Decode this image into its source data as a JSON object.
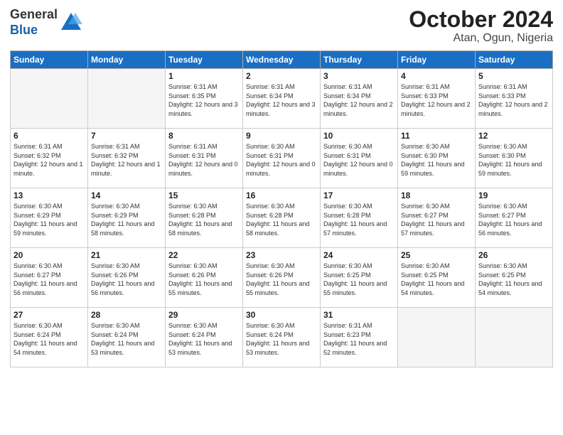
{
  "logo": {
    "general": "General",
    "blue": "Blue"
  },
  "title": {
    "month": "October 2024",
    "location": "Atan, Ogun, Nigeria"
  },
  "headers": [
    "Sunday",
    "Monday",
    "Tuesday",
    "Wednesday",
    "Thursday",
    "Friday",
    "Saturday"
  ],
  "weeks": [
    [
      {
        "day": "",
        "info": ""
      },
      {
        "day": "",
        "info": ""
      },
      {
        "day": "1",
        "info": "Sunrise: 6:31 AM\nSunset: 6:35 PM\nDaylight: 12 hours and 3 minutes."
      },
      {
        "day": "2",
        "info": "Sunrise: 6:31 AM\nSunset: 6:34 PM\nDaylight: 12 hours and 3 minutes."
      },
      {
        "day": "3",
        "info": "Sunrise: 6:31 AM\nSunset: 6:34 PM\nDaylight: 12 hours and 2 minutes."
      },
      {
        "day": "4",
        "info": "Sunrise: 6:31 AM\nSunset: 6:33 PM\nDaylight: 12 hours and 2 minutes."
      },
      {
        "day": "5",
        "info": "Sunrise: 6:31 AM\nSunset: 6:33 PM\nDaylight: 12 hours and 2 minutes."
      }
    ],
    [
      {
        "day": "6",
        "info": "Sunrise: 6:31 AM\nSunset: 6:32 PM\nDaylight: 12 hours and 1 minute."
      },
      {
        "day": "7",
        "info": "Sunrise: 6:31 AM\nSunset: 6:32 PM\nDaylight: 12 hours and 1 minute."
      },
      {
        "day": "8",
        "info": "Sunrise: 6:31 AM\nSunset: 6:31 PM\nDaylight: 12 hours and 0 minutes."
      },
      {
        "day": "9",
        "info": "Sunrise: 6:30 AM\nSunset: 6:31 PM\nDaylight: 12 hours and 0 minutes."
      },
      {
        "day": "10",
        "info": "Sunrise: 6:30 AM\nSunset: 6:31 PM\nDaylight: 12 hours and 0 minutes."
      },
      {
        "day": "11",
        "info": "Sunrise: 6:30 AM\nSunset: 6:30 PM\nDaylight: 11 hours and 59 minutes."
      },
      {
        "day": "12",
        "info": "Sunrise: 6:30 AM\nSunset: 6:30 PM\nDaylight: 11 hours and 59 minutes."
      }
    ],
    [
      {
        "day": "13",
        "info": "Sunrise: 6:30 AM\nSunset: 6:29 PM\nDaylight: 11 hours and 59 minutes."
      },
      {
        "day": "14",
        "info": "Sunrise: 6:30 AM\nSunset: 6:29 PM\nDaylight: 11 hours and 58 minutes."
      },
      {
        "day": "15",
        "info": "Sunrise: 6:30 AM\nSunset: 6:28 PM\nDaylight: 11 hours and 58 minutes."
      },
      {
        "day": "16",
        "info": "Sunrise: 6:30 AM\nSunset: 6:28 PM\nDaylight: 11 hours and 58 minutes."
      },
      {
        "day": "17",
        "info": "Sunrise: 6:30 AM\nSunset: 6:28 PM\nDaylight: 11 hours and 57 minutes."
      },
      {
        "day": "18",
        "info": "Sunrise: 6:30 AM\nSunset: 6:27 PM\nDaylight: 11 hours and 57 minutes."
      },
      {
        "day": "19",
        "info": "Sunrise: 6:30 AM\nSunset: 6:27 PM\nDaylight: 11 hours and 56 minutes."
      }
    ],
    [
      {
        "day": "20",
        "info": "Sunrise: 6:30 AM\nSunset: 6:27 PM\nDaylight: 11 hours and 56 minutes."
      },
      {
        "day": "21",
        "info": "Sunrise: 6:30 AM\nSunset: 6:26 PM\nDaylight: 11 hours and 56 minutes."
      },
      {
        "day": "22",
        "info": "Sunrise: 6:30 AM\nSunset: 6:26 PM\nDaylight: 11 hours and 55 minutes."
      },
      {
        "day": "23",
        "info": "Sunrise: 6:30 AM\nSunset: 6:26 PM\nDaylight: 11 hours and 55 minutes."
      },
      {
        "day": "24",
        "info": "Sunrise: 6:30 AM\nSunset: 6:25 PM\nDaylight: 11 hours and 55 minutes."
      },
      {
        "day": "25",
        "info": "Sunrise: 6:30 AM\nSunset: 6:25 PM\nDaylight: 11 hours and 54 minutes."
      },
      {
        "day": "26",
        "info": "Sunrise: 6:30 AM\nSunset: 6:25 PM\nDaylight: 11 hours and 54 minutes."
      }
    ],
    [
      {
        "day": "27",
        "info": "Sunrise: 6:30 AM\nSunset: 6:24 PM\nDaylight: 11 hours and 54 minutes."
      },
      {
        "day": "28",
        "info": "Sunrise: 6:30 AM\nSunset: 6:24 PM\nDaylight: 11 hours and 53 minutes."
      },
      {
        "day": "29",
        "info": "Sunrise: 6:30 AM\nSunset: 6:24 PM\nDaylight: 11 hours and 53 minutes."
      },
      {
        "day": "30",
        "info": "Sunrise: 6:30 AM\nSunset: 6:24 PM\nDaylight: 11 hours and 53 minutes."
      },
      {
        "day": "31",
        "info": "Sunrise: 6:31 AM\nSunset: 6:23 PM\nDaylight: 11 hours and 52 minutes."
      },
      {
        "day": "",
        "info": ""
      },
      {
        "day": "",
        "info": ""
      }
    ]
  ]
}
